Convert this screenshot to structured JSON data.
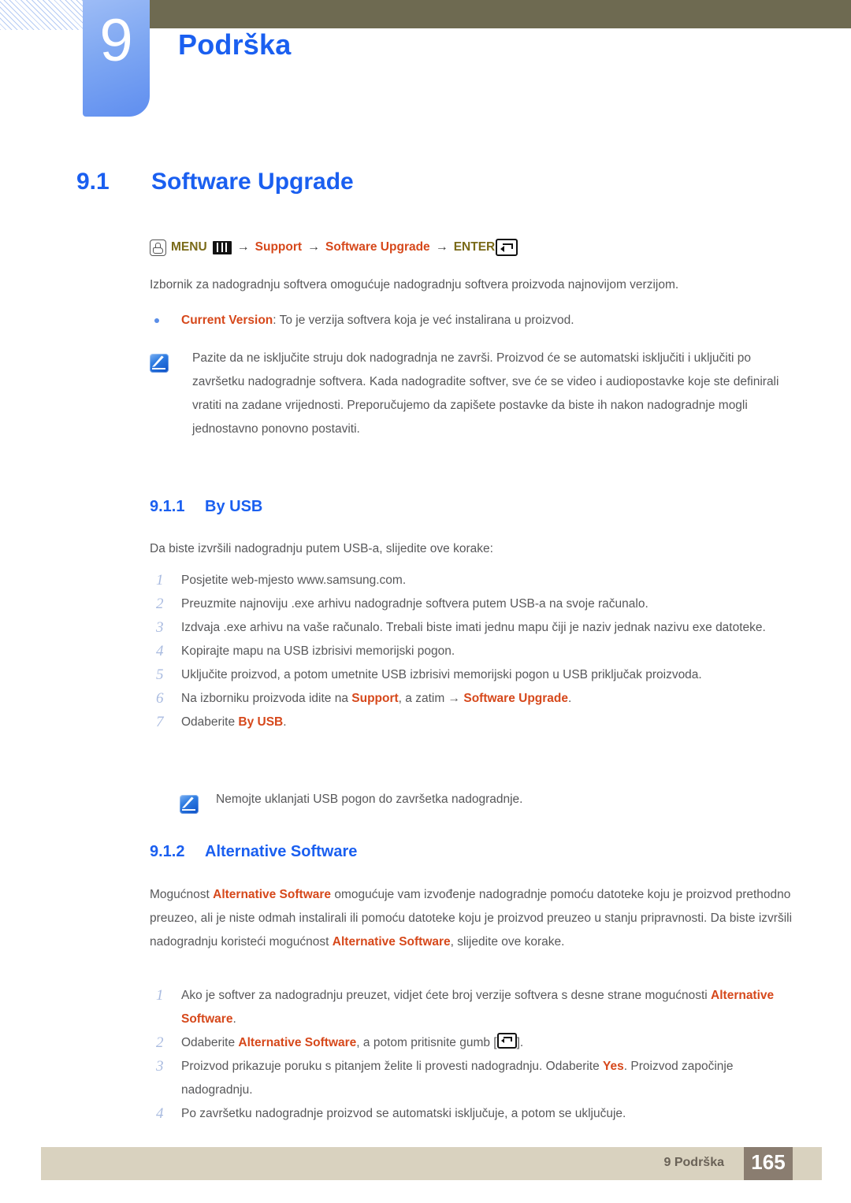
{
  "header": {
    "chapter_number": "9",
    "chapter_title": "Podrška",
    "olive_bar_color": "#6e6a51",
    "tab_color": "#7ea7f2",
    "title_color": "#1a5ff0"
  },
  "section": {
    "number": "9.1",
    "title": "Software Upgrade"
  },
  "breadcrumb": {
    "menu_label": "MENU",
    "items": [
      "Support",
      "Software Upgrade"
    ],
    "enter_label": "ENTER",
    "arrow": "→",
    "olive_color": "#7a6a18",
    "orange_color": "#d6481b"
  },
  "intro_paragraph": "Izbornik za nadogradnju softvera omogućuje nadogradnju softvera proizvoda najnovijom verzijom.",
  "bullet": {
    "term": "Current Version",
    "rest": ": To je verzija softvera koja je već instalirana u proizvod."
  },
  "note_1": "Pazite da ne isključite struju dok nadogradnja ne završi. Proizvod će se automatski isključiti i uključiti po završetku nadogradnje softvera. Kada nadogradite softver, sve će se video i audiopostavke koje ste definirali vratiti na zadane vrijednosti. Preporučujemo da zapišete postavke da biste ih nakon nadogradnje mogli jednostavno ponovno postaviti.",
  "subsection_1": {
    "number": "9.1.1",
    "title": "By USB",
    "lead": "Da biste izvršili nadogradnju putem USB-a, slijedite ove korake:",
    "steps": [
      {
        "num": "1",
        "text": "Posjetite web-mjesto www.samsung.com."
      },
      {
        "num": "2",
        "text": "Preuzmite najnoviju .exe arhivu nadogradnje softvera putem USB-a na svoje računalo."
      },
      {
        "num": "3",
        "text": "Izdvaja .exe arhivu na vaše računalo. Trebali biste imati jednu mapu čiji je naziv jednak nazivu exe datoteke."
      },
      {
        "num": "4",
        "text": "Kopirajte mapu na USB izbrisivi memorijski pogon."
      },
      {
        "num": "5",
        "text": "Uključite proizvod, a potom umetnite USB izbrisivi memorijski pogon u USB priključak proizvoda."
      },
      {
        "num": "6",
        "text_before": "Na izborniku proizvoda idite na ",
        "hl1": "Support",
        "text_mid": ", a zatim → ",
        "hl2": "Software Upgrade",
        "text_after": "."
      },
      {
        "num": "7",
        "text_before": "Odaberite ",
        "hl1": "By USB",
        "text_after": "."
      }
    ],
    "note": "Nemojte uklanjati USB pogon do završetka nadogradnje."
  },
  "subsection_2": {
    "number": "9.1.2",
    "title": "Alternative Software",
    "para": {
      "p1": "Mogućnost ",
      "hl1": "Alternative Software",
      "p2": " omogućuje vam izvođenje nadogradnje pomoću datoteke koju je proizvod prethodno preuzeo, ali je niste odmah instalirali ili pomoću datoteke koju je proizvod preuzeo u stanju pripravnosti. Da biste izvršili nadogradnju koristeći mogućnost ",
      "hl2": "Alternative Software",
      "p3": ", slijedite ove korake."
    },
    "steps": [
      {
        "num": "1",
        "text_before": "Ako je softver za nadogradnju preuzet, vidjet ćete broj verzije softvera s desne strane mogućnosti ",
        "hl1": "Alternative Software",
        "text_after": "."
      },
      {
        "num": "2",
        "text_before": "Odaberite ",
        "hl1": "Alternative Software",
        "text_mid": ", a potom pritisnite gumb [",
        "text_after": "]."
      },
      {
        "num": "3",
        "text_before": "Proizvod prikazuje poruku s pitanjem želite li provesti nadogradnju. Odaberite ",
        "hl1": "Yes",
        "text_after": ". Proizvod započinje nadogradnju."
      },
      {
        "num": "4",
        "text": "Po završetku nadogradnje proizvod se automatski isključuje, a potom se uključuje."
      }
    ]
  },
  "footer": {
    "label": "9 Podrška",
    "page": "165",
    "bar_color": "#d9d2bf",
    "page_box_color": "#8a7d70"
  },
  "icons": {
    "hand_press": "hand-press-icon",
    "menu": "menu-bars-icon",
    "enter": "enter-key-icon",
    "note": "note-pencil-icon",
    "bullet": "bullet-dot-icon"
  }
}
